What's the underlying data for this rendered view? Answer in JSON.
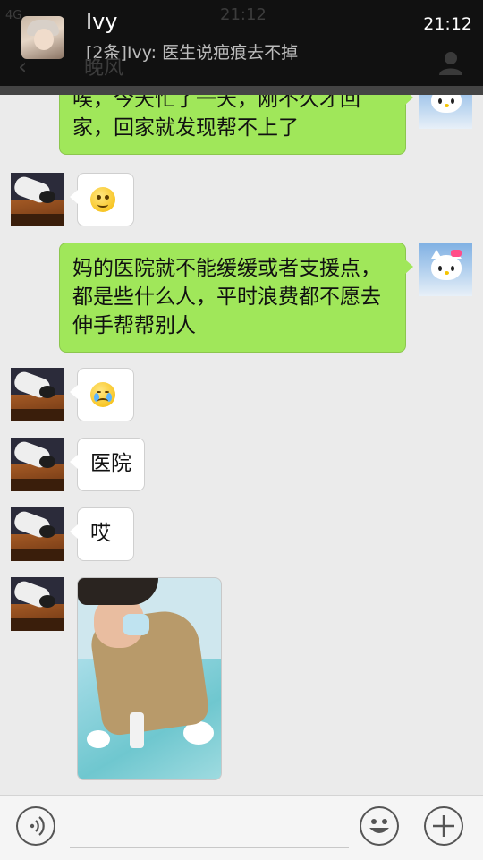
{
  "status_bar": {
    "time": "21:12",
    "network": "4G"
  },
  "notification": {
    "sender": "Ivy",
    "message": "[2条]Ivy: 医生说疤痕去不掉",
    "time": "21:12"
  },
  "chat_header": {
    "title": "晚风"
  },
  "messages": [
    {
      "side": "right",
      "type": "text",
      "text_lines": [
        "唉，今天忙了一天，刚不久才回",
        "家，回家就发现帮不上了"
      ]
    },
    {
      "side": "left",
      "type": "emoji",
      "emoji": "awkward-face"
    },
    {
      "side": "right",
      "type": "text",
      "text_lines": [
        "妈的医院就不能缓缓或者支援点，",
        "都是些什么人，平时浪费都不愿去",
        "伸手帮帮别人"
      ]
    },
    {
      "side": "left",
      "type": "emoji",
      "emoji": "crying-face"
    },
    {
      "side": "left",
      "type": "text",
      "text": "医院"
    },
    {
      "side": "left",
      "type": "text",
      "text": "哎"
    },
    {
      "side": "left",
      "type": "image",
      "image": "patient-in-hospital-bed-photo"
    }
  ],
  "input_bar": {
    "voice_icon": "voice-icon",
    "emoji_icon": "smiley-icon",
    "plus_icon": "plus-icon"
  },
  "colors": {
    "sent_bubble": "#a0e75a",
    "received_bubble": "#ffffff",
    "background": "#ebebeb",
    "notification_bg": "#111111"
  }
}
